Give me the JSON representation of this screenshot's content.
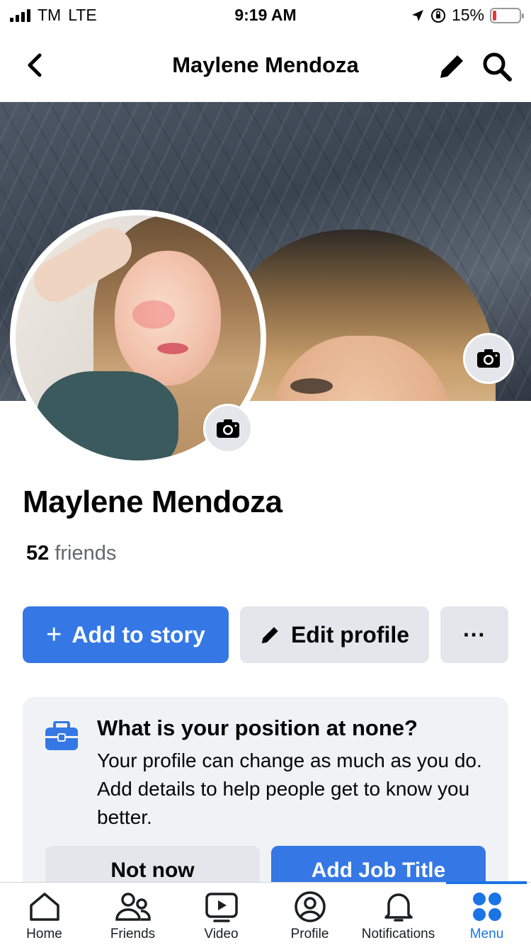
{
  "status_bar": {
    "carrier": "TM",
    "network": "LTE",
    "time": "9:19 AM",
    "battery": "15%",
    "battery_level": 0.15
  },
  "nav": {
    "title": "Maylene Mendoza"
  },
  "profile": {
    "name": "Maylene Mendoza",
    "friends_count": "52",
    "friends_label": "friends"
  },
  "actions": {
    "add_story": "Add to story",
    "edit_profile": "Edit profile",
    "more": "···"
  },
  "prompt_card": {
    "title": "What is your position at none?",
    "text": "Your profile can change as much as you do. Add details to help people get to know you better.",
    "not_now": "Not now",
    "add_job": "Add Job Title"
  },
  "tab_bar": {
    "items": [
      {
        "label": "Home",
        "icon": "home-icon"
      },
      {
        "label": "Friends",
        "icon": "friends-icon"
      },
      {
        "label": "Video",
        "icon": "video-icon"
      },
      {
        "label": "Profile",
        "icon": "profile-icon"
      },
      {
        "label": "Notifications",
        "icon": "bell-icon"
      },
      {
        "label": "Menu",
        "icon": "menu-icon"
      }
    ],
    "active": "Menu"
  },
  "colors": {
    "accent": "#3578e5",
    "secondary_button": "#e4e6eb",
    "card_bg": "#f0f2f5"
  }
}
